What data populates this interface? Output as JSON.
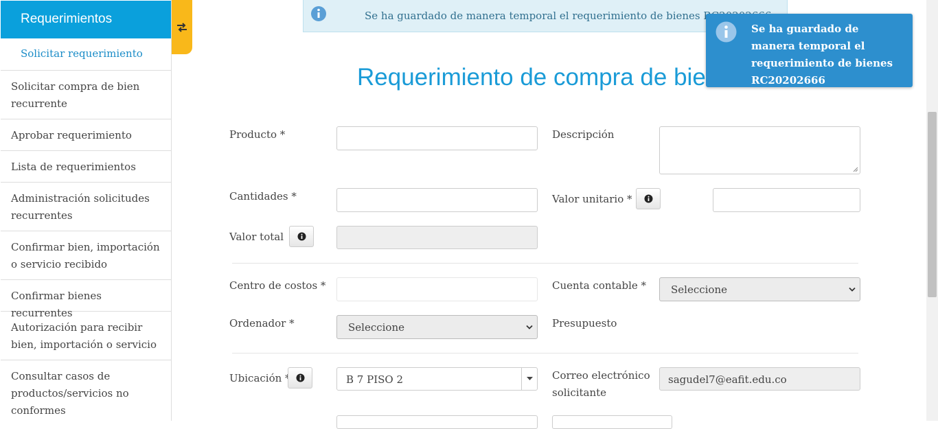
{
  "sidebar": {
    "title": "Requerimientos",
    "active_item": "Solicitar requerimiento",
    "items": [
      {
        "label": "Solicitar compra de bien recurrente"
      },
      {
        "label": "Aprobar requerimiento"
      },
      {
        "label": "Lista de requerimientos"
      },
      {
        "label": "Administración solicitudes recurrentes"
      },
      {
        "label": "Confirmar bien, importación o servicio recibido"
      },
      {
        "label": "Confirmar bienes recurrentes"
      },
      {
        "label": "Autorización para recibir bien, importación o servicio"
      },
      {
        "label": "Consultar casos de productos/servicios no conformes"
      }
    ]
  },
  "alert": {
    "message": "Se ha guardado de manera temporal el requerimiento de bienes RC20202666"
  },
  "toast": {
    "message": "Se ha guardado de manera temporal el requerimiento de bienes RC20202666"
  },
  "page_title": "Requerimiento de compra de bienes",
  "form": {
    "producto_label": "Producto *",
    "descripcion_label": "Descripción",
    "cantidades_label": "Cantidades *",
    "valor_unitario_label": "Valor unitario *",
    "valor_total_label": "Valor total",
    "centro_costos_label": "Centro de costos *",
    "cuenta_contable_label": "Cuenta contable *",
    "cuenta_contable_value": "Seleccione",
    "ordenador_label": "Ordenador *",
    "ordenador_value": "Seleccione",
    "presupuesto_label": "Presupuesto",
    "ubicacion_label": "Ubicación *",
    "ubicacion_value": "B 7 PISO 2",
    "correo_label": "Correo electrónico solicitante",
    "correo_value": "sagudel7@eafit.edu.co"
  },
  "colors": {
    "accent": "#0aa0dc",
    "toggle": "#f9b81a",
    "toast": "#2d8fce",
    "alert_bg": "#dff0f7"
  }
}
